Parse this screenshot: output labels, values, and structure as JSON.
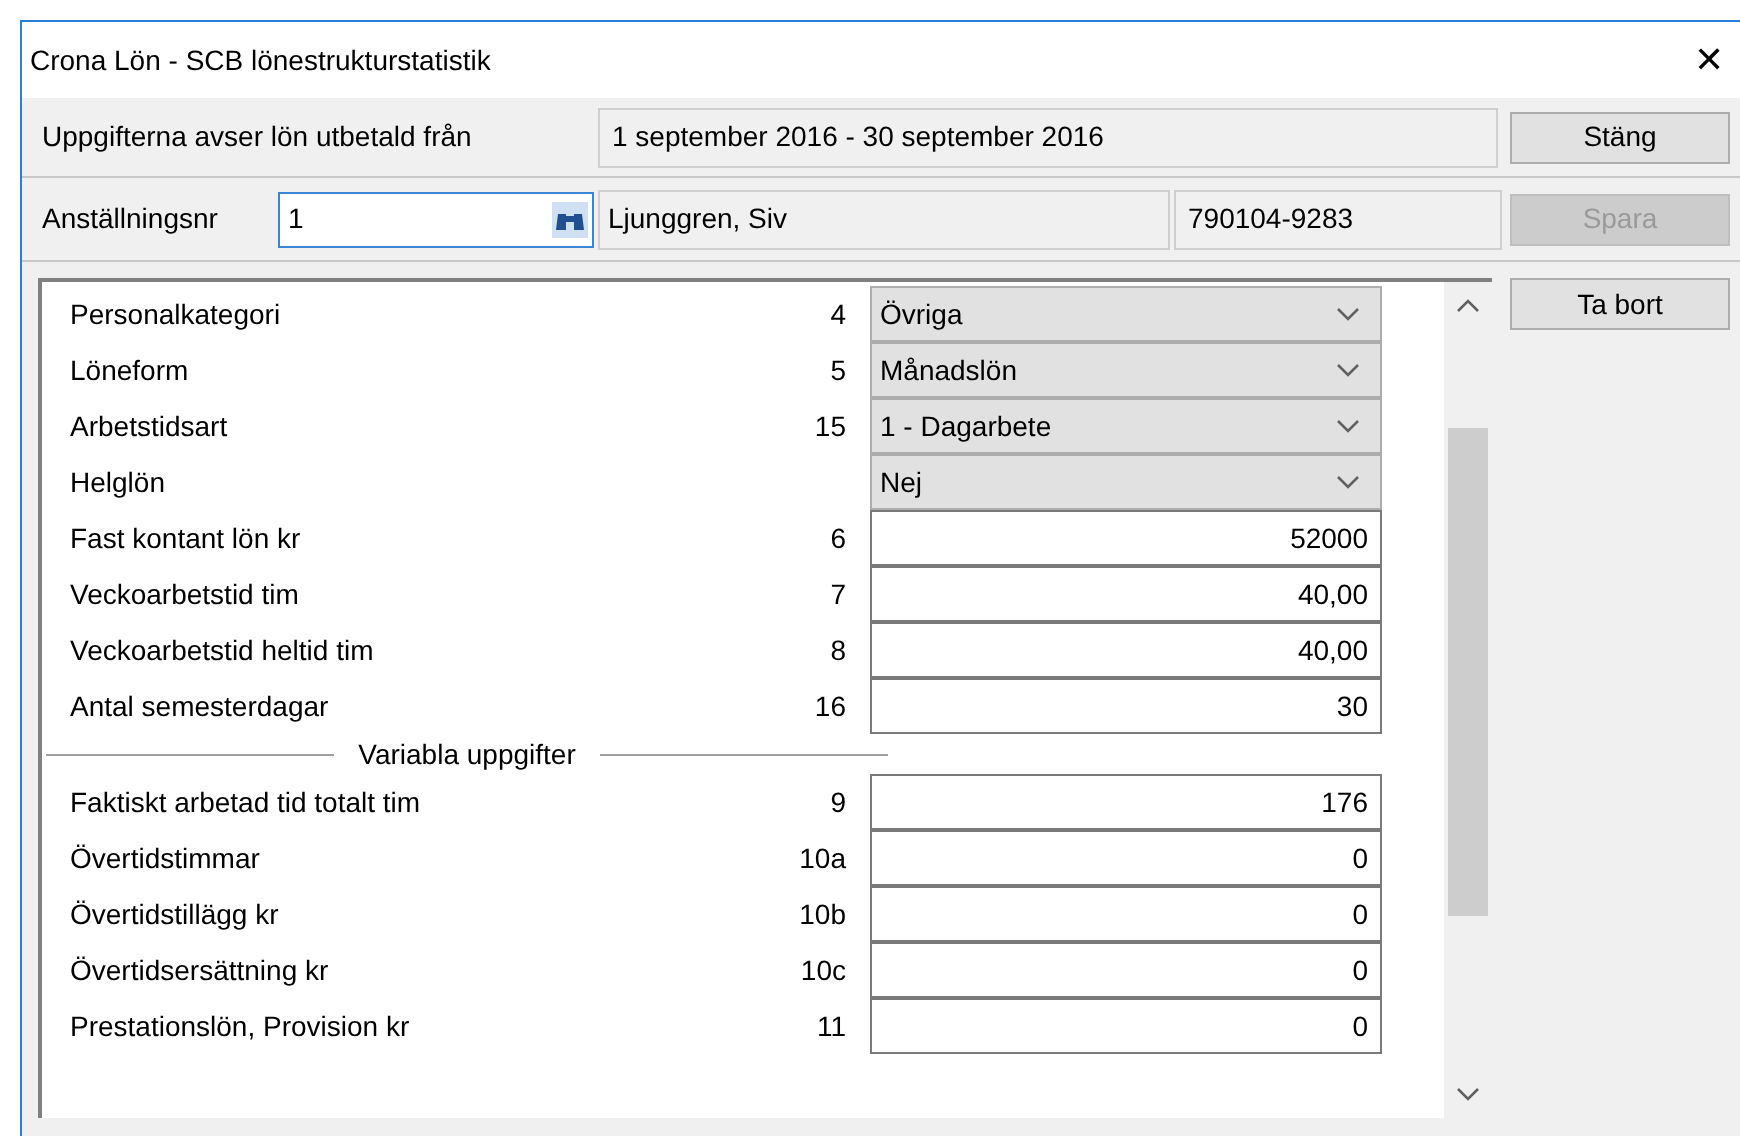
{
  "window": {
    "title": "Crona Lön - SCB lönestrukturstatistik",
    "close": "✕"
  },
  "period": {
    "label": "Uppgifterna avser lön utbetald från",
    "value": "1 september 2016 - 30 september 2016"
  },
  "employee": {
    "label": "Anställningsnr",
    "number": "1",
    "name": "Ljunggren, Siv",
    "id": "790104-9283"
  },
  "buttons": [
    {
      "label": "Stäng",
      "disabled": false
    },
    {
      "label": "Spara",
      "disabled": true
    },
    {
      "label": "Ta bort",
      "disabled": false
    }
  ],
  "rows": [
    {
      "kind": "select",
      "label": "Personalkategori",
      "code": "4",
      "value": "Övriga"
    },
    {
      "kind": "select",
      "label": "Löneform",
      "code": "5",
      "value": "Månadslön"
    },
    {
      "kind": "select",
      "label": "Arbetstidsart",
      "code": "15",
      "value": "1 - Dagarbete"
    },
    {
      "kind": "select",
      "label": "Helglön",
      "value": "Nej"
    },
    {
      "kind": "input",
      "label": "Fast kontant lön kr",
      "code": "6",
      "value": "52000"
    },
    {
      "kind": "input",
      "label": "Veckoarbetstid tim",
      "code": "7",
      "value": "40,00"
    },
    {
      "kind": "input",
      "label": "Veckoarbetstid heltid tim",
      "code": "8",
      "value": "40,00"
    },
    {
      "kind": "input",
      "label": "Antal semesterdagar",
      "code": "16",
      "value": "30"
    },
    {
      "kind": "section",
      "label": "Variabla uppgifter"
    },
    {
      "kind": "input",
      "label": "Faktiskt arbetad tid totalt tim",
      "code": "9",
      "value": "176"
    },
    {
      "kind": "input",
      "label": "Övertidstimmar",
      "code": "10a",
      "value": "0"
    },
    {
      "kind": "input",
      "label": "Övertidstillägg kr",
      "code": "10b",
      "value": "0"
    },
    {
      "kind": "input",
      "label": "Övertidsersättning kr",
      "code": "10c",
      "value": "0"
    },
    {
      "kind": "input",
      "label": "Prestationslön, Provision kr",
      "code": "11",
      "value": "0"
    }
  ]
}
